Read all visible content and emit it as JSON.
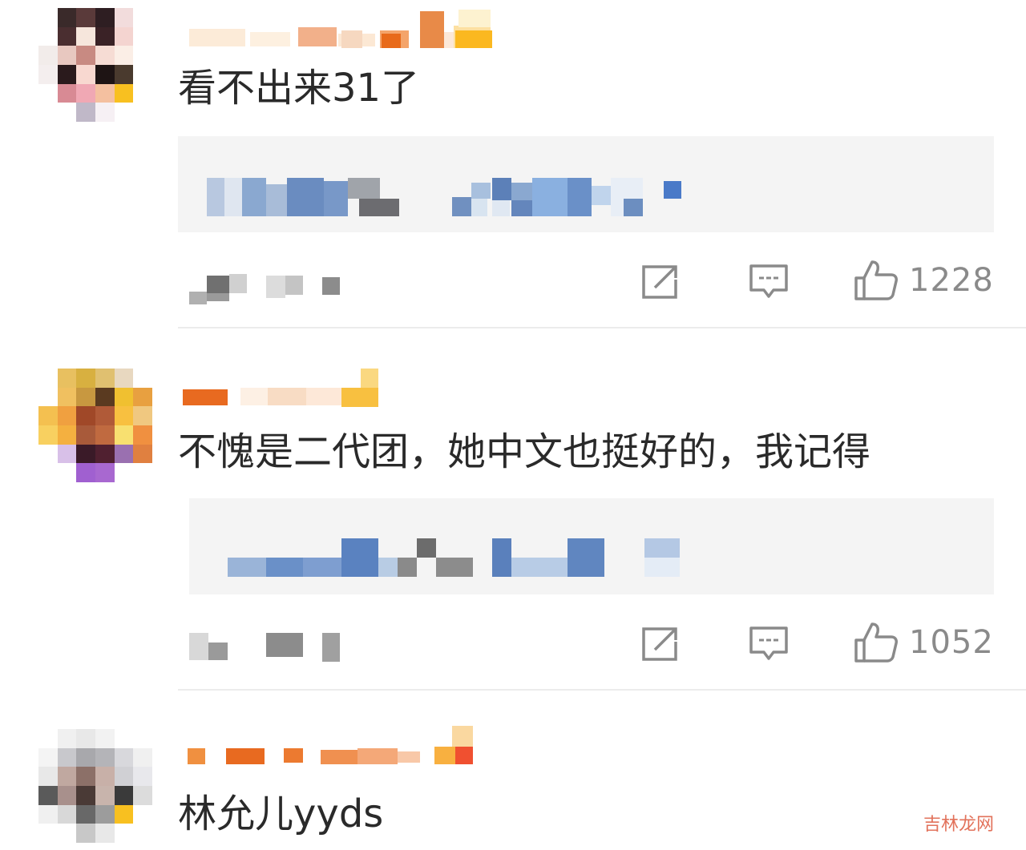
{
  "comments": [
    {
      "text": "看不出来31了",
      "actions": {
        "share_icon": "share-icon",
        "reply_icon": "comment-icon",
        "like_icon": "thumbs-up-icon"
      },
      "like_count": "1228"
    },
    {
      "text": "不愧是二代团，她中文也挺好的，我记得",
      "actions": {
        "share_icon": "share-icon",
        "reply_icon": "comment-icon",
        "like_icon": "thumbs-up-icon"
      },
      "like_count": "1052"
    },
    {
      "text": "林允儿yyds"
    }
  ],
  "watermark": "吉林龙网",
  "colors": {
    "text": "#2a2a2a",
    "icon": "#8a8a8a",
    "reply_bg": "#f4f4f4",
    "watermark": "#e2725b"
  }
}
